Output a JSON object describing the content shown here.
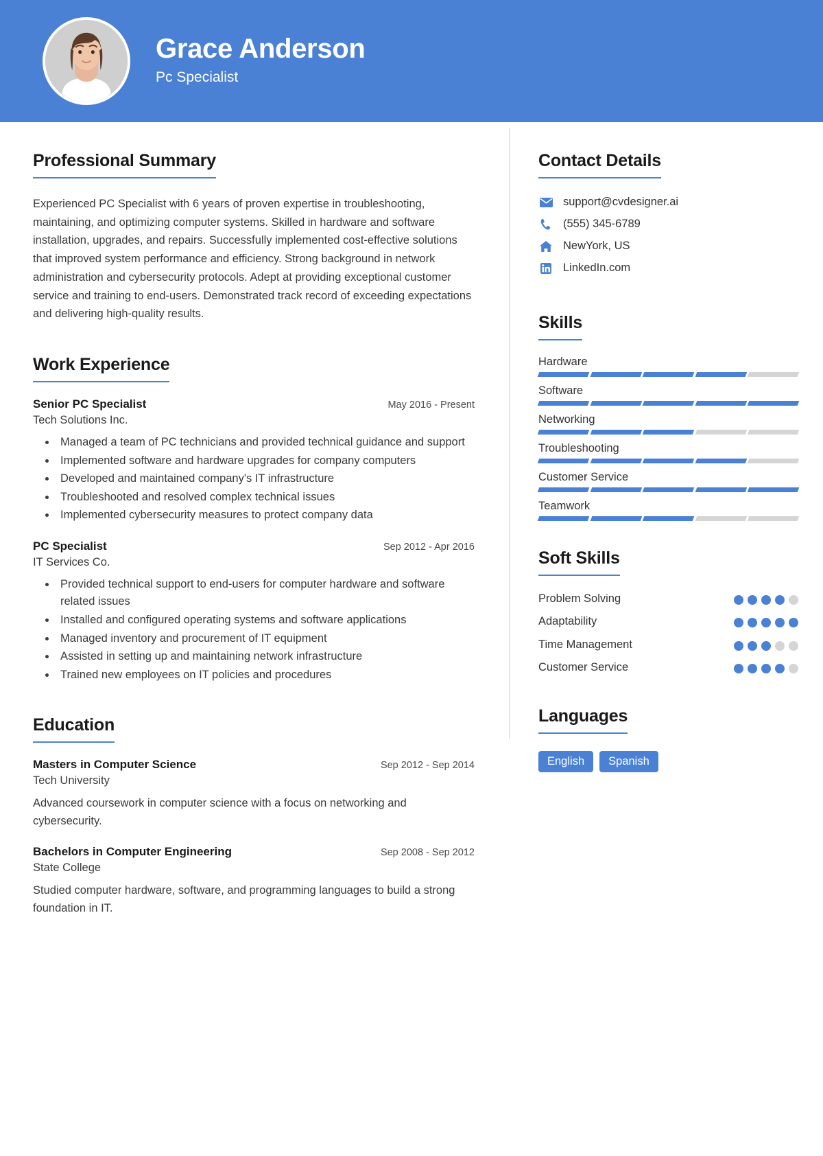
{
  "header": {
    "name": "Grace Anderson",
    "role": "Pc Specialist",
    "avatar_icon": "person-photo",
    "accent_color": "#4a81d4"
  },
  "summary": {
    "title": "Professional Summary",
    "text": "Experienced PC Specialist with 6 years of proven expertise in troubleshooting, maintaining, and optimizing computer systems. Skilled in hardware and software installation, upgrades, and repairs. Successfully implemented cost-effective solutions that improved system performance and efficiency. Strong background in network administration and cybersecurity protocols. Adept at providing exceptional customer service and training to end-users. Demonstrated track record of exceeding expectations and delivering high-quality results."
  },
  "work": {
    "title": "Work Experience",
    "entries": [
      {
        "position": "Senior PC Specialist",
        "date": "May 2016 - Present",
        "company": "Tech Solutions Inc.",
        "bullets": [
          "Managed a team of PC technicians and provided technical guidance and support",
          "Implemented software and hardware upgrades for company computers",
          "Developed and maintained company's IT infrastructure",
          "Troubleshooted and resolved complex technical issues",
          "Implemented cybersecurity measures to protect company data"
        ]
      },
      {
        "position": "PC Specialist",
        "date": "Sep 2012 - Apr 2016",
        "company": "IT Services Co.",
        "bullets": [
          "Provided technical support to end-users for computer hardware and software related issues",
          "Installed and configured operating systems and software applications",
          "Managed inventory and procurement of IT equipment",
          "Assisted in setting up and maintaining network infrastructure",
          "Trained new employees on IT policies and procedures"
        ]
      }
    ]
  },
  "education": {
    "title": "Education",
    "entries": [
      {
        "degree": "Masters in Computer Science",
        "date": "Sep 2012 - Sep 2014",
        "school": "Tech University",
        "description": "Advanced coursework in computer science with a focus on networking and cybersecurity."
      },
      {
        "degree": "Bachelors in Computer Engineering",
        "date": "Sep 2008 - Sep 2012",
        "school": "State College",
        "description": "Studied computer hardware, software, and programming languages to build a strong foundation in IT."
      }
    ]
  },
  "contact": {
    "title": "Contact Details",
    "items": [
      {
        "icon": "envelope-icon",
        "value": "support@cvdesigner.ai"
      },
      {
        "icon": "phone-icon",
        "value": "(555) 345-6789"
      },
      {
        "icon": "home-icon",
        "value": "NewYork, US"
      },
      {
        "icon": "linkedin-icon",
        "value": "LinkedIn.com"
      }
    ]
  },
  "skills": {
    "title": "Skills",
    "max": 5,
    "items": [
      {
        "name": "Hardware",
        "level": 4
      },
      {
        "name": "Software",
        "level": 5
      },
      {
        "name": "Networking",
        "level": 3
      },
      {
        "name": "Troubleshooting",
        "level": 4
      },
      {
        "name": "Customer Service",
        "level": 5
      },
      {
        "name": "Teamwork",
        "level": 3
      }
    ]
  },
  "soft_skills": {
    "title": "Soft Skills",
    "max": 5,
    "items": [
      {
        "name": "Problem Solving",
        "level": 4
      },
      {
        "name": "Adaptability",
        "level": 5
      },
      {
        "name": "Time Management",
        "level": 3
      },
      {
        "name": "Customer Service",
        "level": 4
      }
    ]
  },
  "languages": {
    "title": "Languages",
    "items": [
      "English",
      "Spanish"
    ]
  }
}
